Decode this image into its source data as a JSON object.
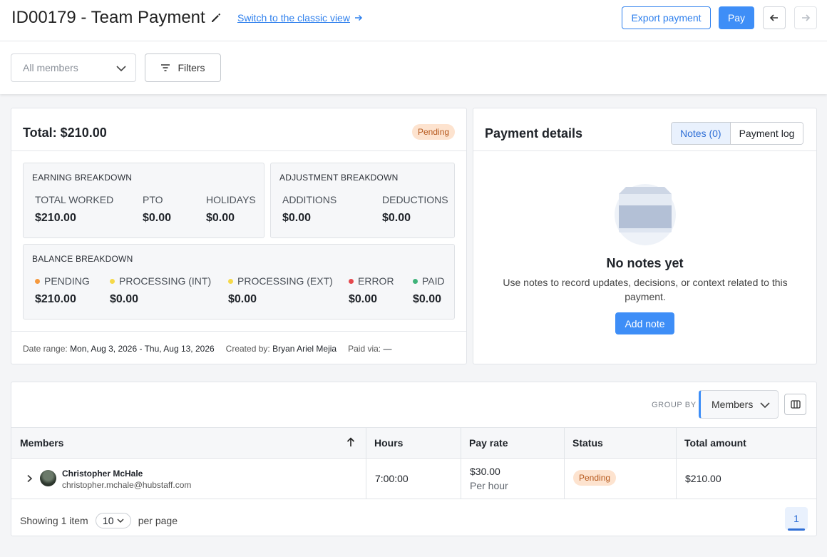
{
  "header": {
    "title": "ID00179 - Team Payment",
    "classic_link": "Switch to the classic view",
    "export_label": "Export payment",
    "pay_label": "Pay"
  },
  "filters": {
    "members_placeholder": "All members",
    "filters_label": "Filters"
  },
  "summary": {
    "total": "Total: $210.00",
    "status": "Pending",
    "earning": {
      "title": "EARNING BREAKDOWN",
      "items": [
        {
          "label": "TOTAL WORKED",
          "value": "$210.00"
        },
        {
          "label": "PTO",
          "value": "$0.00"
        },
        {
          "label": "HOLIDAYS",
          "value": "$0.00"
        }
      ]
    },
    "adjustment": {
      "title": "ADJUSTMENT BREAKDOWN",
      "items": [
        {
          "label": "ADDITIONS",
          "value": "$0.00"
        },
        {
          "label": "DEDUCTIONS",
          "value": "$0.00"
        }
      ]
    },
    "balance": {
      "title": "BALANCE BREAKDOWN",
      "items": [
        {
          "label": "PENDING",
          "value": "$210.00",
          "color": "#f5993d"
        },
        {
          "label": "PROCESSING (INT)",
          "value": "$0.00",
          "color": "#f5d94a"
        },
        {
          "label": "PROCESSING (EXT)",
          "value": "$0.00",
          "color": "#f5d94a"
        },
        {
          "label": "ERROR",
          "value": "$0.00",
          "color": "#e5484d"
        },
        {
          "label": "PAID",
          "value": "$0.00",
          "color": "#3fb37a"
        }
      ]
    },
    "meta": {
      "date_label": "Date range:",
      "date_value": "Mon, Aug 3, 2026 - Thu, Aug 13, 2026",
      "created_label": "Created by:",
      "created_value": "Bryan Ariel Mejia",
      "paid_label": "Paid via:",
      "paid_value": "—"
    }
  },
  "details": {
    "title": "Payment details",
    "tab_notes": "Notes (0)",
    "tab_log": "Payment log",
    "empty_title": "No notes yet",
    "empty_desc": "Use notes to record updates, decisions, or context related to this payment.",
    "add_note": "Add note"
  },
  "table": {
    "group_by_label": "GROUP BY",
    "group_by_value": "Members",
    "columns": [
      "Members",
      "Hours",
      "Pay rate",
      "Status",
      "Total amount"
    ],
    "rows": [
      {
        "name": "Christopher McHale",
        "email": "christopher.mchale@hubstaff.com",
        "hours": "7:00:00",
        "rate": "$30.00",
        "rate_unit": "Per hour",
        "status": "Pending",
        "total": "$210.00"
      }
    ],
    "footer": {
      "showing": "Showing 1 item",
      "per_page_value": "10",
      "per_page_label": "per page",
      "page": "1"
    }
  },
  "colors": {
    "accent": "#3e8ef7",
    "link": "#2f80ed",
    "pending_bg": "#fde3cf",
    "pending_text": "#b5571a"
  }
}
